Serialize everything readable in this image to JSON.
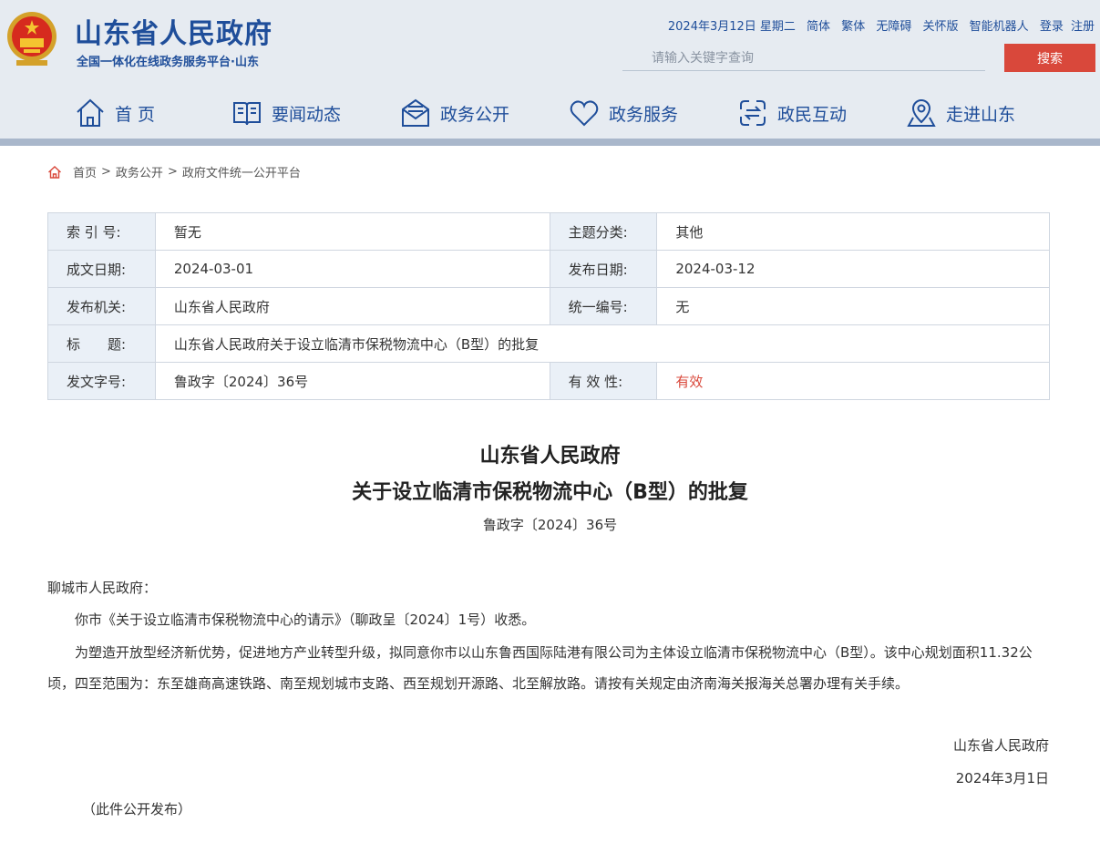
{
  "header": {
    "title": "山东省人民政府",
    "subtitle": "全国一体化在线政务服务平台·山东",
    "date": "2024年3月12日 星期二",
    "links": [
      "简体",
      "繁体",
      "无障碍",
      "关怀版",
      "智能机器人",
      "登录",
      "注册"
    ],
    "search_placeholder": "请输入关键字查询",
    "search_button": "搜索"
  },
  "nav": {
    "items": [
      {
        "label": "首 页",
        "icon": "home-icon"
      },
      {
        "label": "要闻动态",
        "icon": "book-icon"
      },
      {
        "label": "政务公开",
        "icon": "mail-icon"
      },
      {
        "label": "政务服务",
        "icon": "heart-icon"
      },
      {
        "label": "政民互动",
        "icon": "exchange-icon"
      },
      {
        "label": "走进山东",
        "icon": "map-pin-icon"
      }
    ]
  },
  "breadcrumb": [
    "首页",
    "政务公开",
    "政府文件统一公开平台"
  ],
  "meta": {
    "index_label": "索 引 号:",
    "index_value": "暂无",
    "topic_label": "主题分类:",
    "topic_value": "其他",
    "written_label": "成文日期:",
    "written_value": "2024-03-01",
    "publish_label": "发布日期:",
    "publish_value": "2024-03-12",
    "org_label": "发布机关:",
    "org_value": "山东省人民政府",
    "code_label": "统一编号:",
    "code_value": "无",
    "title_label": "标　　题:",
    "title_value": "山东省人民政府关于设立临清市保税物流中心（B型）的批复",
    "docno_label": "发文字号:",
    "docno_value": "鲁政字〔2024〕36号",
    "validity_label": "有 效 性:",
    "validity_value": "有效"
  },
  "document": {
    "title_line1": "山东省人民政府",
    "title_line2": "关于设立临清市保税物流中心（B型）的批复",
    "doc_no": "鲁政字〔2024〕36号",
    "salutation": "聊城市人民政府：",
    "para1": "你市《关于设立临清市保税物流中心的请示》（聊政呈〔2024〕1号）收悉。",
    "para2": "为塑造开放型经济新优势，促进地方产业转型升级，拟同意你市以山东鲁西国际陆港有限公司为主体设立临清市保税物流中心（B型）。该中心规划面积11.32公顷，四至范围为：东至雄商高速铁路、南至规划城市支路、西至规划开源路、北至解放路。请按有关规定由济南海关报海关总署办理有关手续。",
    "signature": "山东省人民政府",
    "sign_date": "2024年3月1日",
    "note": "（此件公开发布）"
  },
  "colors": {
    "brand_blue": "#1f4e9a",
    "accent_red": "#d9483b",
    "header_bg": "#e6ebf1",
    "table_label_bg": "#eaf0f7"
  }
}
